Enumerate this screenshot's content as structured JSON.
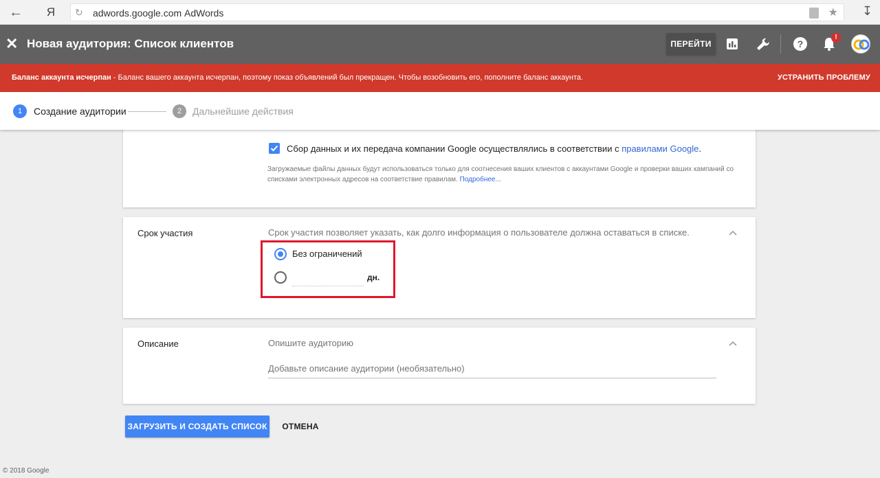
{
  "browser": {
    "domain": "adwords.google.com",
    "page_title": "AdWords",
    "yandex_label": "Я"
  },
  "header": {
    "title": "Новая аудитория: Список клиентов",
    "goto_label": "ПЕРЕЙТИ",
    "notification_count": "!"
  },
  "alert": {
    "bold": "Баланс аккаунта исчерпан",
    "message": " - Баланс вашего аккаунта исчерпан, поэтому показ объявлений был прекращен. Чтобы возобновить его, пополните баланс аккаунта.",
    "action": "УСТРАНИТЬ ПРОБЛЕМУ",
    "color": "#d0392b"
  },
  "stepper": {
    "steps": [
      {
        "number": "1",
        "label": "Создание аудитории",
        "active": true
      },
      {
        "number": "2",
        "label": "Дальнейшие действия",
        "active": false
      }
    ]
  },
  "consent": {
    "checked": true,
    "text": "Сбор данных и их передача компании Google осуществлялись в соответствии с ",
    "link": "правилами Google",
    "text_end": ".",
    "help": "Загружаемые файлы данных будут использоваться только для соотнесения ваших клиентов с аккаунтами Google и проверки ваших кампаний со списками электронных адресов на соответствие правилам. ",
    "help_link": "Подробнее..."
  },
  "membership": {
    "label": "Срок участия",
    "description": "Срок участия позволяет указать, как долго информация о пользователе должна оставаться в списке.",
    "option_unlimited": "Без ограничений",
    "days_value": "",
    "days_suffix": "дн.",
    "selected": "unlimited"
  },
  "description_section": {
    "label": "Описание",
    "hint": "Опишите аудиторию",
    "placeholder": "Добавьте описание аудитории (необязательно)"
  },
  "actions": {
    "primary": "ЗАГРУЗИТЬ И СОЗДАТЬ СПИСОК",
    "cancel": "ОТМЕНА"
  },
  "footer": {
    "copyright": "© 2018 Google"
  },
  "colors": {
    "accent": "#4285f4",
    "header": "#616161",
    "highlight": "#e0162b"
  }
}
